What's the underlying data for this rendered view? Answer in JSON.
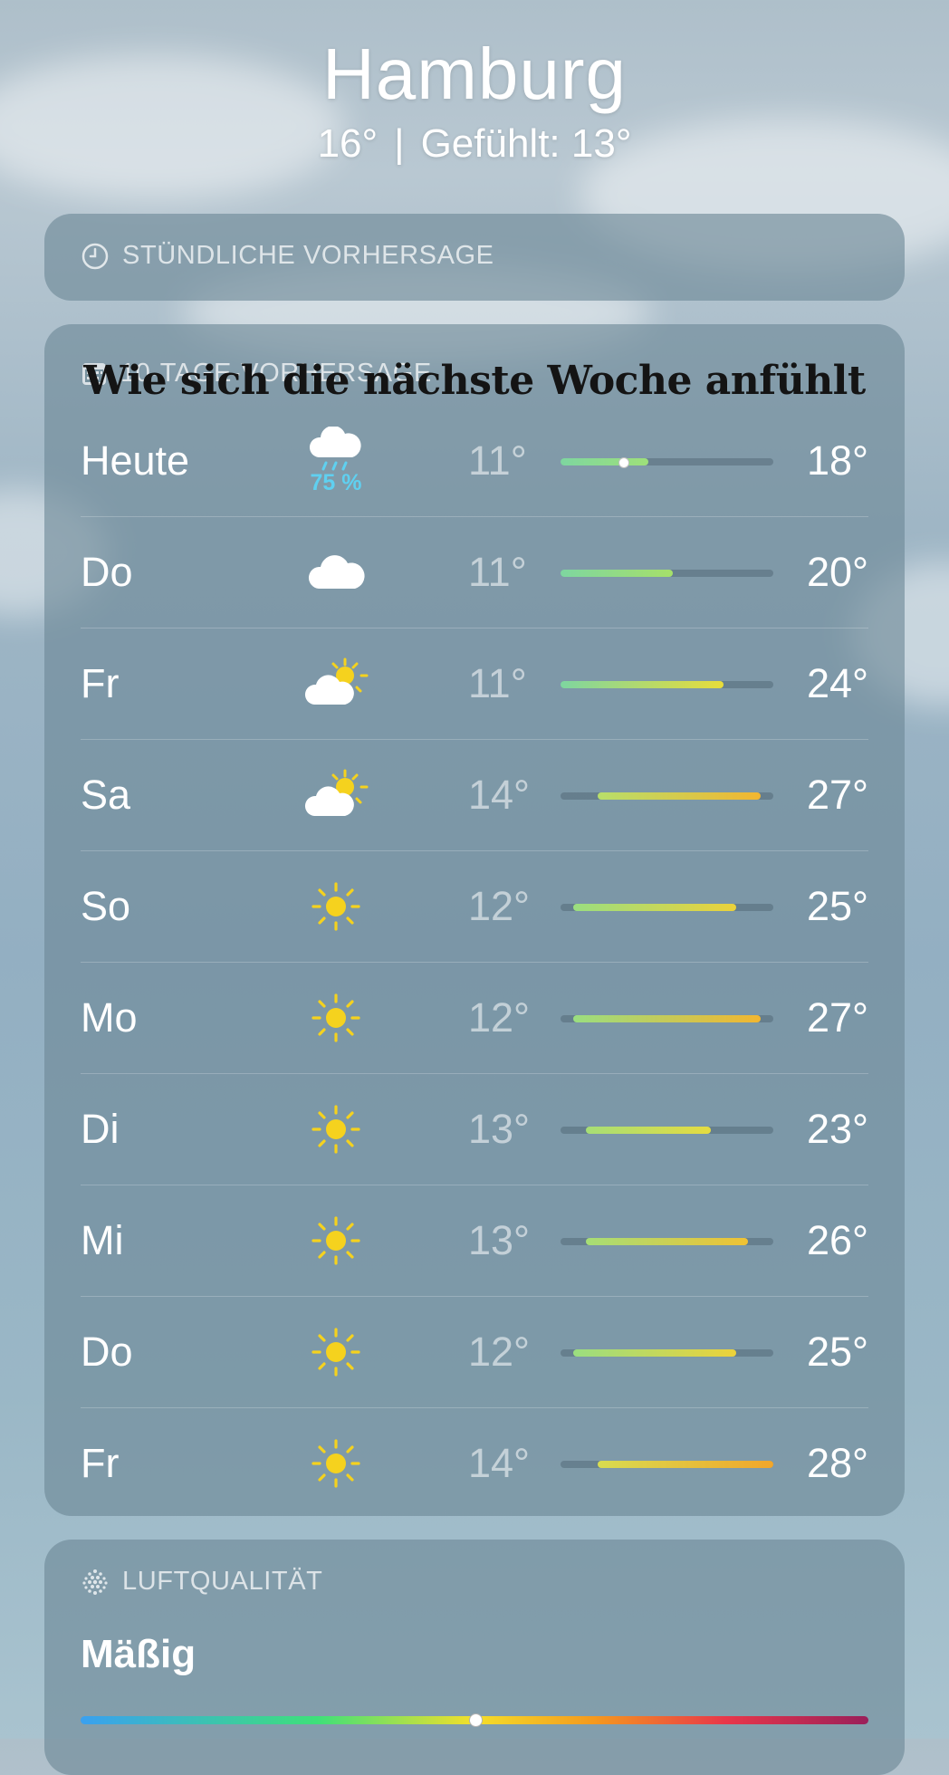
{
  "header": {
    "city": "Hamburg",
    "temp": "16°",
    "separator": "|",
    "feels_like": "Gefühlt: 13°"
  },
  "hourly": {
    "title": "STÜNDLICHE VORHERSAGE",
    "icon": "clock-icon"
  },
  "daily": {
    "title": "10-TAGE-VORHERSAGE",
    "icon": "calendar-icon",
    "overlay_caption": "Wie sich die nächste Woche anfühlt",
    "range_min": 11,
    "range_max": 28,
    "days": [
      {
        "day": "Heute",
        "icon": "cloud-rain-icon",
        "precip": "75 %",
        "low": "11°",
        "high": "18°",
        "low_val": 11,
        "high_val": 18,
        "current": 16,
        "colors": [
          "#7ed6a0",
          "#9ee07a"
        ]
      },
      {
        "day": "Do",
        "icon": "cloud-icon",
        "precip": "",
        "low": "11°",
        "high": "20°",
        "low_val": 11,
        "high_val": 20,
        "colors": [
          "#7ed6a0",
          "#a6e06a"
        ]
      },
      {
        "day": "Fr",
        "icon": "cloud-sun-icon",
        "precip": "",
        "low": "11°",
        "high": "24°",
        "low_val": 11,
        "high_val": 24,
        "colors": [
          "#7ed6a0",
          "#e8dc3a"
        ]
      },
      {
        "day": "Sa",
        "icon": "cloud-sun-icon",
        "precip": "",
        "low": "14°",
        "high": "27°",
        "low_val": 14,
        "high_val": 27,
        "colors": [
          "#b8df6a",
          "#f2b630"
        ]
      },
      {
        "day": "So",
        "icon": "sun-icon",
        "precip": "",
        "low": "12°",
        "high": "25°",
        "low_val": 12,
        "high_val": 25,
        "colors": [
          "#9ade80",
          "#ecd23a"
        ]
      },
      {
        "day": "Mo",
        "icon": "sun-icon",
        "precip": "",
        "low": "12°",
        "high": "27°",
        "low_val": 12,
        "high_val": 27,
        "colors": [
          "#9ade80",
          "#f2b630"
        ]
      },
      {
        "day": "Di",
        "icon": "sun-icon",
        "precip": "",
        "low": "13°",
        "high": "23°",
        "low_val": 13,
        "high_val": 23,
        "colors": [
          "#a6de76",
          "#e6dc40"
        ]
      },
      {
        "day": "Mi",
        "icon": "sun-icon",
        "precip": "",
        "low": "13°",
        "high": "26°",
        "low_val": 13,
        "high_val": 26,
        "colors": [
          "#a6de76",
          "#f0c234"
        ]
      },
      {
        "day": "Do",
        "icon": "sun-icon",
        "precip": "",
        "low": "12°",
        "high": "25°",
        "low_val": 12,
        "high_val": 25,
        "colors": [
          "#9ade80",
          "#ecd23a"
        ]
      },
      {
        "day": "Fr",
        "icon": "sun-icon",
        "precip": "",
        "low": "14°",
        "high": "28°",
        "low_val": 14,
        "high_val": 28,
        "colors": [
          "#d8dc50",
          "#f2a62a"
        ]
      }
    ]
  },
  "air_quality": {
    "title": "LUFTQUALITÄT",
    "icon": "air-quality-icon",
    "value": "Mäßig",
    "level": 0.5
  }
}
